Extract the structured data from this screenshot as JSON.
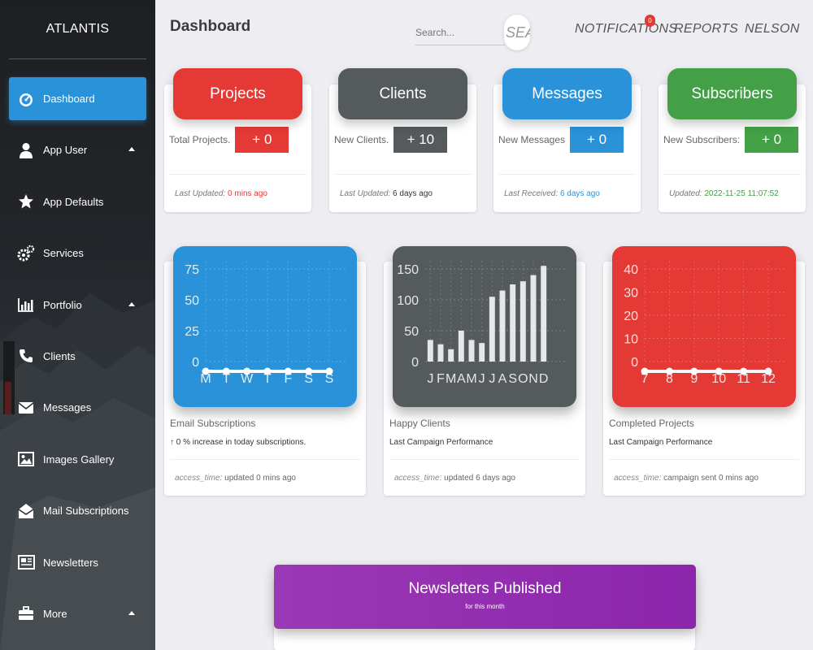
{
  "app": {
    "brand": "ATLANTIS",
    "page_title": "Dashboard"
  },
  "sidebar": {
    "items": [
      {
        "label": "Dashboard",
        "icon": "dashboard-icon",
        "active": true,
        "caret": false
      },
      {
        "label": "App User",
        "icon": "user-icon",
        "active": false,
        "caret": true
      },
      {
        "label": "App Defaults",
        "icon": "star-icon",
        "active": false,
        "caret": false
      },
      {
        "label": "Services",
        "icon": "gears-icon",
        "active": false,
        "caret": false
      },
      {
        "label": "Portfolio",
        "icon": "bar-chart-icon",
        "active": false,
        "caret": true
      },
      {
        "label": "Clients",
        "icon": "phone-icon",
        "active": false,
        "caret": false
      },
      {
        "label": "Messages",
        "icon": "envelope-icon",
        "active": false,
        "caret": false
      },
      {
        "label": "Images Gallery",
        "icon": "image-icon",
        "active": false,
        "caret": false
      },
      {
        "label": "Mail Subscriptions",
        "icon": "envelope-open-icon",
        "active": false,
        "caret": false
      },
      {
        "label": "Newsletters",
        "icon": "newspaper-icon",
        "active": false,
        "caret": false
      },
      {
        "label": "More",
        "icon": "briefcase-icon",
        "active": false,
        "caret": true
      }
    ]
  },
  "topbar": {
    "search_placeholder": "Search...",
    "search_button": "SEARCH",
    "notifications": "NOTIFICATIONS",
    "notifications_count": "0",
    "reports": "REPORTS",
    "user": "NELSON"
  },
  "stats": [
    {
      "title": "Projects",
      "label": "Total Projects.",
      "value": "+ 0",
      "foot_label": "Last Updated:",
      "foot_value": "0 mins ago",
      "color": "#e53935",
      "foot_color": "#e53935"
    },
    {
      "title": "Clients",
      "label": "New Clients.",
      "value": "+ 10",
      "foot_label": "Last Updated:",
      "foot_value": "6 days ago",
      "color": "#555a5c",
      "foot_color": "#333333"
    },
    {
      "title": "Messages",
      "label": "New Messages",
      "value": "+ 0",
      "foot_label": "Last Received:",
      "foot_value": "6 days ago",
      "color": "#2a92d9",
      "foot_color": "#2a92d9"
    },
    {
      "title": "Subscribers",
      "label": "New Subscribers:",
      "value": "+ 0",
      "foot_label": "Updated:",
      "foot_value": "2022-11-25 11:07:52",
      "color": "#43a047",
      "foot_color": "#43a047"
    }
  ],
  "charts": [
    {
      "title": "Email Subscriptions",
      "subtitle": "0 % increase in today subscriptions.",
      "foot_label": "access_time:",
      "foot_value": "updated 0 mins ago",
      "color": "#2a92d9"
    },
    {
      "title": "Happy Clients",
      "subtitle": "Last Campaign Performance",
      "foot_label": "access_time:",
      "foot_value": "updated 6 days ago",
      "color": "#555a5c"
    },
    {
      "title": "Completed Projects",
      "subtitle": "Last Campaign Performance",
      "foot_label": "access_time:",
      "foot_value": "campaign sent 0 mins ago",
      "color": "#e53935"
    }
  ],
  "chart_data": [
    {
      "type": "line",
      "categories": [
        "M",
        "T",
        "W",
        "T",
        "F",
        "S",
        "S"
      ],
      "values": [
        0,
        0,
        0,
        0,
        0,
        0,
        0
      ],
      "ylim": [
        0,
        75
      ],
      "yticks": [
        0,
        25,
        50,
        75
      ],
      "grid": true
    },
    {
      "type": "bar",
      "categories": [
        "J",
        "F",
        "M",
        "A",
        "M",
        "J",
        "J",
        "A",
        "S",
        "O",
        "N",
        "D"
      ],
      "values": [
        35,
        28,
        20,
        50,
        35,
        30,
        105,
        115,
        125,
        130,
        140,
        155
      ],
      "ylim": [
        0,
        150
      ],
      "yticks": [
        0,
        50,
        100,
        150
      ],
      "grid": true
    },
    {
      "type": "line",
      "categories": [
        "7",
        "8",
        "9",
        "10",
        "11",
        "12"
      ],
      "values": [
        0,
        0,
        0,
        0,
        0,
        0
      ],
      "ylim": [
        0,
        40
      ],
      "yticks": [
        0,
        10,
        20,
        30,
        40
      ],
      "grid": true
    }
  ],
  "newsletters": {
    "title": "Newsletters Published",
    "subtitle": "for this month"
  }
}
